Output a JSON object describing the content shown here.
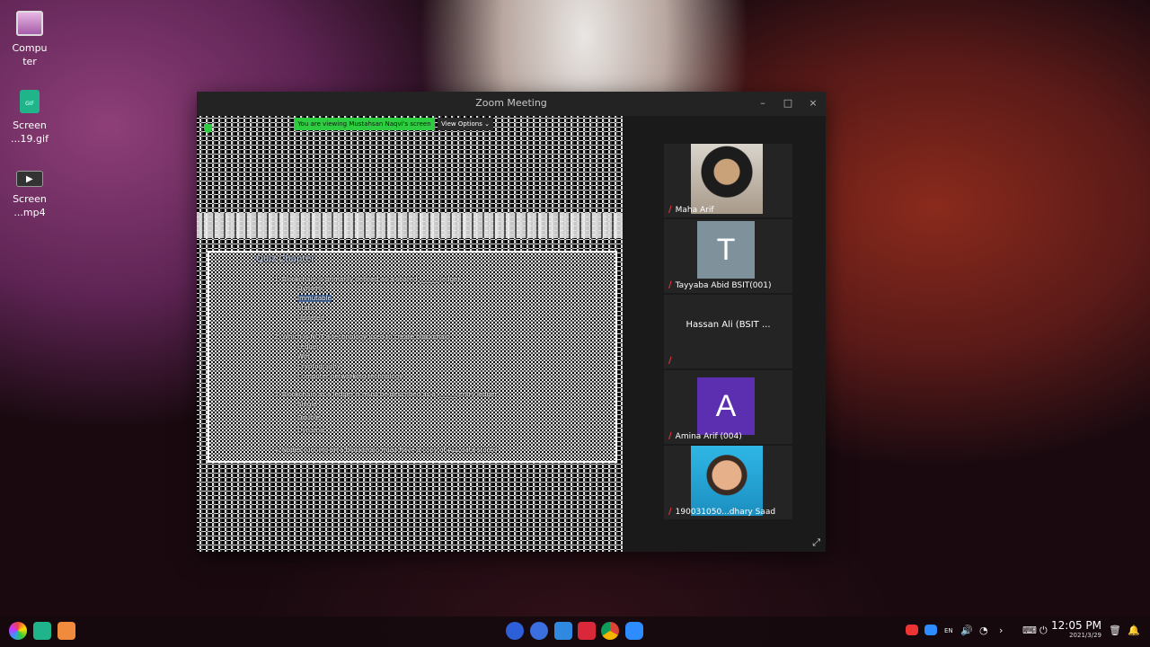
{
  "desktop": {
    "icons": [
      {
        "label": "Compu\nter",
        "icon": "computer-icon"
      },
      {
        "label": "Screen\n...19.gif",
        "icon": "gif-file-icon"
      },
      {
        "label": "Screen\n...mp4",
        "icon": "video-file-icon"
      }
    ]
  },
  "window": {
    "title": "Zoom Meeting",
    "minimize": "–",
    "maximize": "□",
    "close": "×"
  },
  "share": {
    "banner": "You are viewing Mustahsan Naqvi's screen",
    "view_options": "View Options ⌄",
    "doc_title": "Quiz Chapter",
    "lines": [
      "1.  Blockchain is primarily defined as a shared ______ ledger",
      "Dynamic",
      "Immutable",
      "Static",
      "Updated",
      "2.  Which is NOT a technology used to create blockchain",
      "Ledger",
      "Wifi",
      "Cryptography",
      "Computer networking technology",
      "3.  Blockchain as a ledger is must be described as a ______ entry ledger",
      "Single",
      "Double",
      "Dynamic",
      "4.  Nodes running on a blockchain must have a copy of ALL data stored"
    ]
  },
  "participants": [
    {
      "name": "Maha Arif",
      "type": "photo"
    },
    {
      "name": "Tayyaba Abid BSIT(001)",
      "type": "letter",
      "letter": "T",
      "color": "#7f929b"
    },
    {
      "name": "Hassan Ali (BSIT ...",
      "type": "name-only"
    },
    {
      "name": "Amina Arif (004)",
      "type": "letter",
      "letter": "A",
      "color": "#5b2fb0"
    },
    {
      "name": "190031050...dhary Saad",
      "type": "photo"
    }
  ],
  "taskbar": {
    "time": "12:05 PM",
    "date": "2021/3/29",
    "lang": "EN"
  }
}
